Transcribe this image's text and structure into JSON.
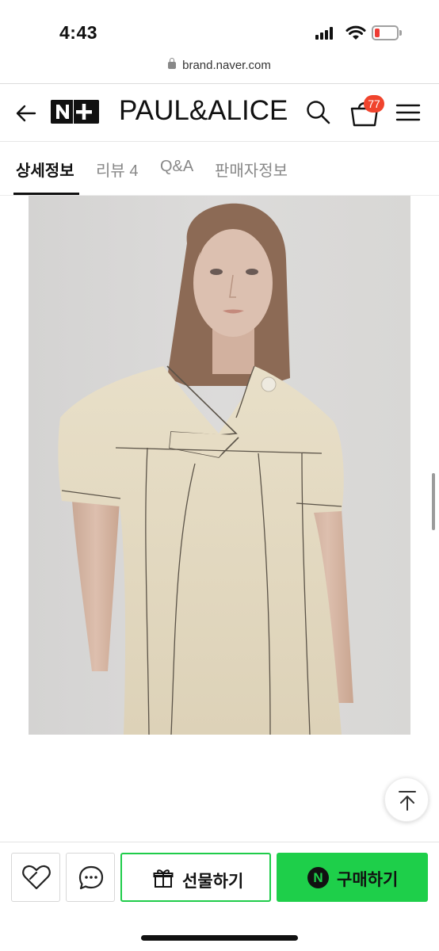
{
  "status_bar": {
    "time": "4:43",
    "battery_color": "#ee3b34"
  },
  "browser": {
    "url": "brand.naver.com"
  },
  "header": {
    "logo_text": "N+",
    "brand": "PAUL&ALICE",
    "cart_count": "77",
    "icons": [
      "back-arrow-icon",
      "search-icon",
      "cart-icon",
      "menu-icon"
    ]
  },
  "tabs": [
    {
      "label": "상세정보",
      "active": true
    },
    {
      "label": "리뷰 4",
      "active": false
    },
    {
      "label": "Q&A",
      "active": false
    },
    {
      "label": "판매자정보",
      "active": false
    }
  ],
  "bottom_bar": {
    "gift_label": "선물하기",
    "buy_label": "구매하기",
    "npay_mark": "N",
    "accent_color": "#1ecf4a"
  }
}
